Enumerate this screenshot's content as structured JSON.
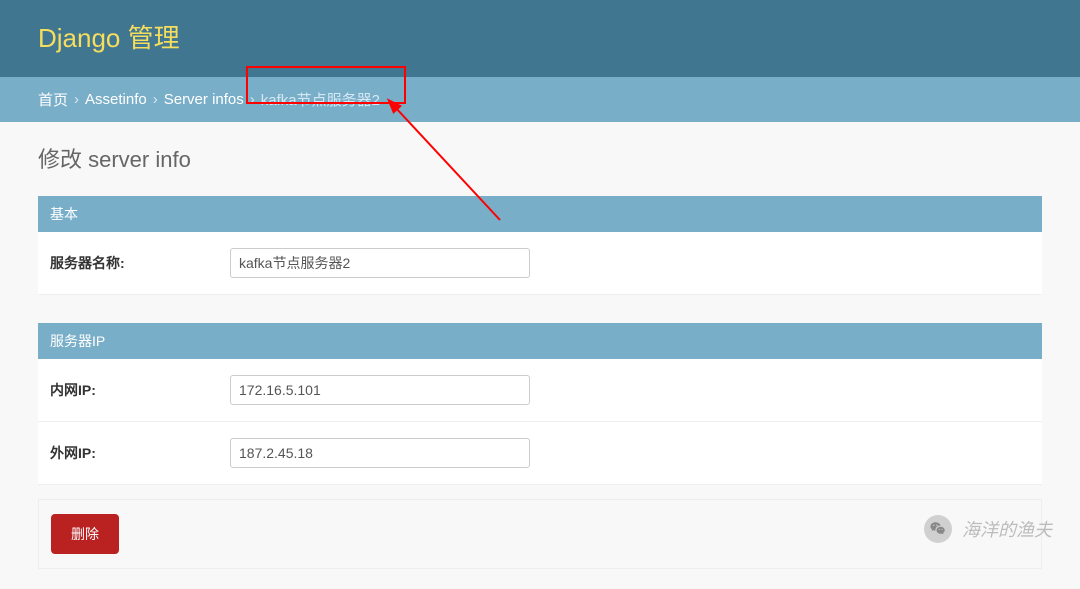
{
  "header": {
    "site_title": "Django 管理"
  },
  "breadcrumb": {
    "items": [
      "首页",
      "Assetinfo",
      "Server infos"
    ],
    "current": "kafka节点服务器2",
    "sep": "›"
  },
  "page": {
    "title": "修改 server info"
  },
  "fieldsets": {
    "basic": {
      "legend": "基本",
      "fields": {
        "server_name": {
          "label": "服务器名称:",
          "value": "kafka节点服务器2"
        }
      }
    },
    "ip": {
      "legend": "服务器IP",
      "fields": {
        "internal_ip": {
          "label": "内网IP:",
          "value": "172.16.5.101"
        },
        "external_ip": {
          "label": "外网IP:",
          "value": "187.2.45.18"
        }
      }
    }
  },
  "actions": {
    "delete_label": "删除"
  },
  "watermark": {
    "text": "海洋的渔夫"
  }
}
